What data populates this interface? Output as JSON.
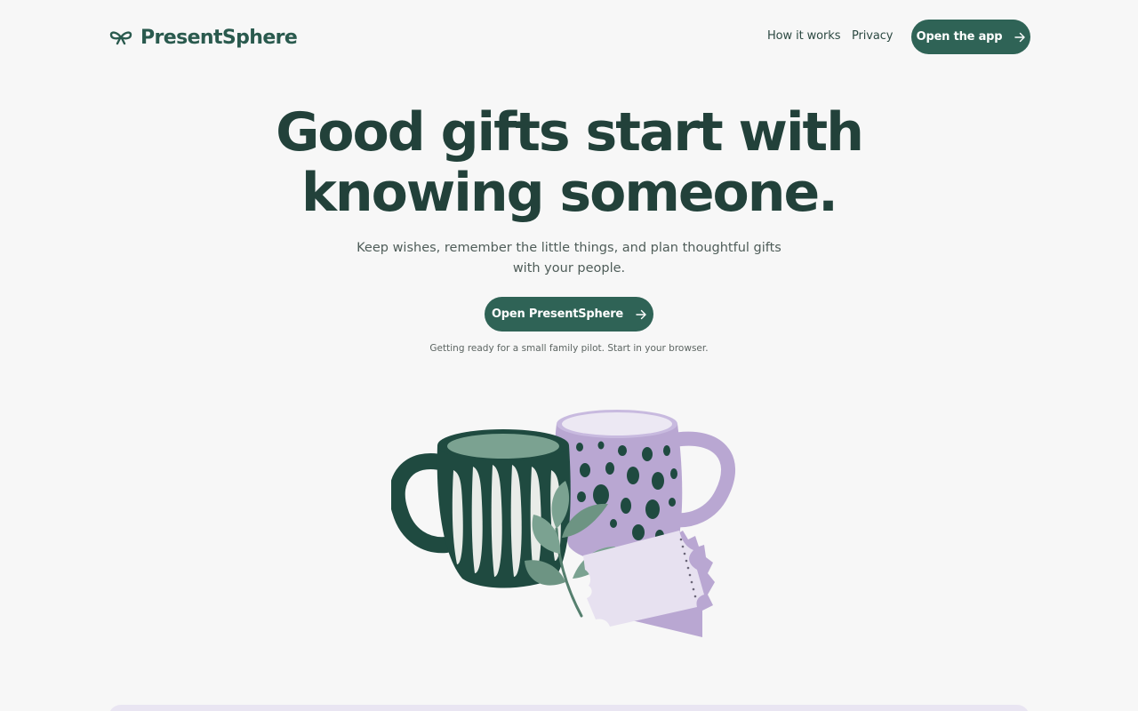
{
  "brand": {
    "name": "PresentSphere",
    "icon": "bow-icon"
  },
  "nav": {
    "links": [
      "How it works",
      "Privacy"
    ],
    "cta_label": "Open the app"
  },
  "hero": {
    "title": "Good gifts start with knowing someone.",
    "subtitle": "Keep wishes, remember the little things, and plan thoughtful gifts with your people.",
    "cta_label": "Open PresentSphere",
    "note": "Getting ready for a small family pilot. Start in your browser."
  },
  "colors": {
    "accent": "#2f6356",
    "heading": "#22413a",
    "background": "#f7f7f7",
    "lavender": "#b9a7d2",
    "dark_green": "#1f4a40"
  }
}
